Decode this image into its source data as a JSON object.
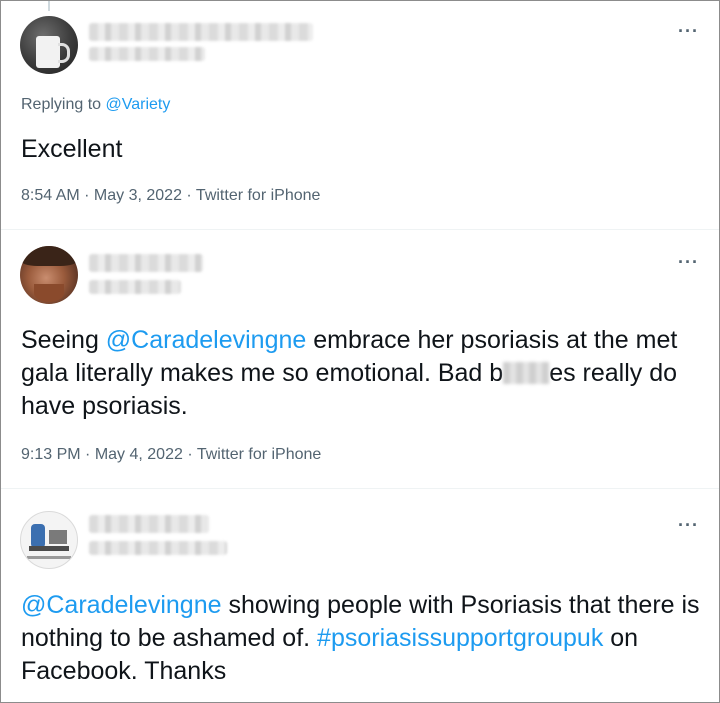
{
  "tweets": [
    {
      "replying_prefix": "Replying to",
      "replying_handle": "@Variety",
      "text": "Excellent",
      "time": "8:54 AM",
      "date": "May 3, 2022",
      "source": "Twitter for iPhone",
      "more": "···"
    },
    {
      "text_part1": "Seeing ",
      "mention": "@Caradelevingne",
      "text_part2": " embrace her psoriasis at the met gala literally makes me so emotional. Bad b",
      "text_part3": "es really do have psoriasis.",
      "time": "9:13 PM",
      "date": "May 4, 2022",
      "source": "Twitter for iPhone",
      "more": "···"
    },
    {
      "mention": "@Caradelevingne",
      "text_part1": " showing people with Psoriasis that there is nothing to be ashamed of. ",
      "hashtag": "#psoriasissupportgroupuk",
      "text_part2": " on Facebook. Thanks",
      "more": "···"
    }
  ],
  "separator": " · ",
  "colors": {
    "link": "#1d9bf0",
    "secondary": "#536471",
    "text": "#0f1419",
    "divider": "#eff3f4"
  },
  "icons": [
    "more-icon"
  ]
}
